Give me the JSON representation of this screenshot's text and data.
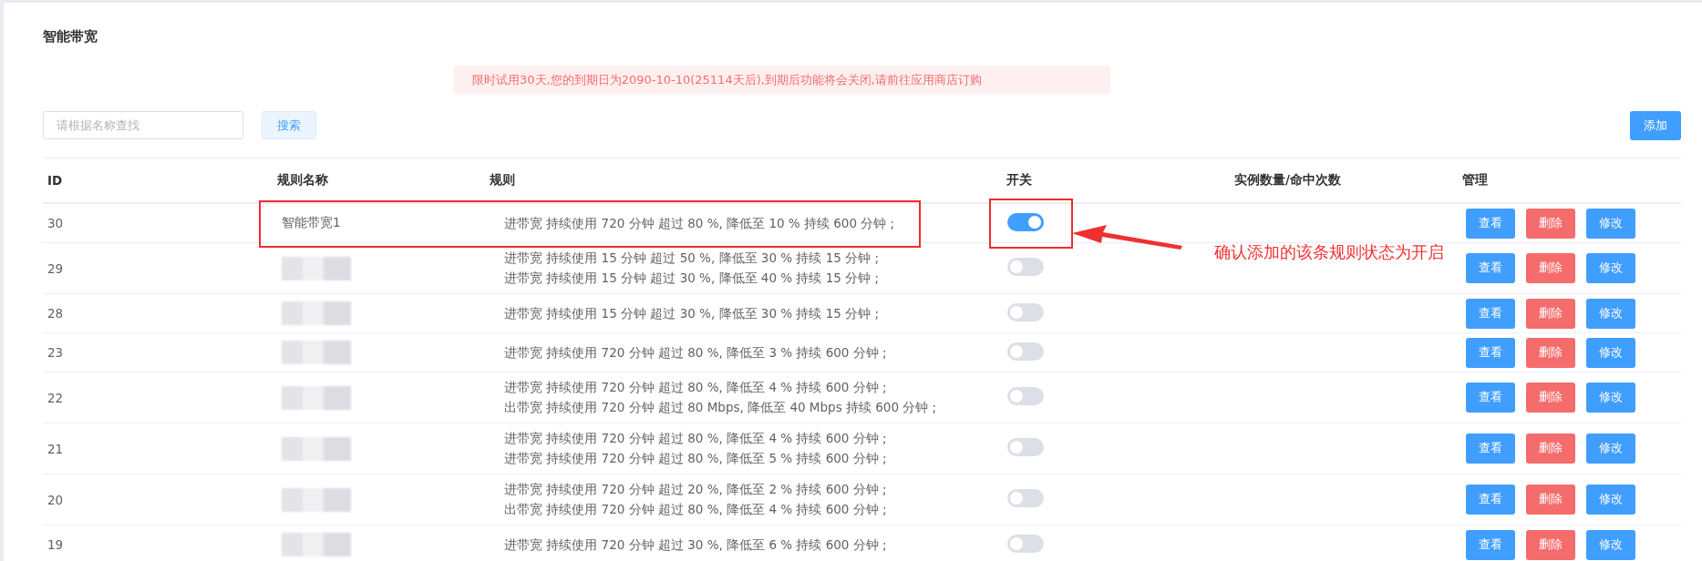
{
  "page": {
    "title": "智能带宽"
  },
  "notice": "限时试用30天,您的到期日为2090-10-10(25114天后),到期后功能将会关闭,请前往应用商店订购",
  "search": {
    "placeholder": "请根据名称查找",
    "button": "搜索"
  },
  "add_button": "添加",
  "table": {
    "columns": [
      "ID",
      "规则名称",
      "规则",
      "开关",
      "实例数量/命中次数",
      "管理"
    ],
    "rows": [
      {
        "id": "30",
        "name": "智能带宽1",
        "name_blurred": false,
        "rules": [
          "进带宽 持续使用 720 分钟 超过 80 %, 降低至 10 % 持续 600 分钟 ;"
        ],
        "on": true,
        "actions": [
          {
            "label": "查看",
            "kind": "view"
          },
          {
            "label": "删除",
            "kind": "delete"
          },
          {
            "label": "修改",
            "kind": "edit"
          }
        ]
      },
      {
        "id": "29",
        "name_blurred": true,
        "rules": [
          "进带宽 持续使用 15 分钟 超过 50 %, 降低至 30 % 持续 15 分钟 ;",
          "进带宽 持续使用 15 分钟 超过 30 %, 降低至 40 % 持续 15 分钟 ;"
        ],
        "on": false,
        "actions": [
          {
            "label": "查看",
            "kind": "view"
          },
          {
            "label": "删除",
            "kind": "delete"
          },
          {
            "label": "修改",
            "kind": "edit"
          }
        ]
      },
      {
        "id": "28",
        "name_blurred": true,
        "rules": [
          "进带宽 持续使用 15 分钟 超过 30 %, 降低至 30 % 持续 15 分钟 ;"
        ],
        "on": false,
        "actions": [
          {
            "label": "查看",
            "kind": "view"
          },
          {
            "label": "删除",
            "kind": "delete"
          },
          {
            "label": "修改",
            "kind": "edit"
          }
        ]
      },
      {
        "id": "23",
        "name_blurred": true,
        "rules": [
          "进带宽 持续使用 720 分钟 超过 80 %, 降低至 3 % 持续 600 分钟 ;"
        ],
        "on": false,
        "actions": [
          {
            "label": "查看",
            "kind": "view"
          },
          {
            "label": "删除",
            "kind": "delete"
          },
          {
            "label": "修改",
            "kind": "edit"
          }
        ]
      },
      {
        "id": "22",
        "name_blurred": true,
        "rules": [
          "进带宽 持续使用 720 分钟 超过 80 %, 降低至 4 % 持续 600 分钟 ;",
          "出带宽 持续使用 720 分钟 超过 80 Mbps, 降低至 40 Mbps 持续 600 分钟 ;"
        ],
        "on": false,
        "actions": [
          {
            "label": "查看",
            "kind": "view"
          },
          {
            "label": "删除",
            "kind": "delete"
          },
          {
            "label": "修改",
            "kind": "edit"
          }
        ]
      },
      {
        "id": "21",
        "name_blurred": true,
        "rules": [
          "进带宽 持续使用 720 分钟 超过 80 %, 降低至 4 % 持续 600 分钟 ;",
          "进带宽 持续使用 720 分钟 超过 80 %, 降低至 5 % 持续 600 分钟 ;"
        ],
        "on": false,
        "actions": [
          {
            "label": "查看",
            "kind": "view"
          },
          {
            "label": "删除",
            "kind": "delete"
          },
          {
            "label": "修改",
            "kind": "edit"
          }
        ]
      },
      {
        "id": "20",
        "name_blurred": true,
        "rules": [
          "进带宽 持续使用 720 分钟 超过 20 %, 降低至 2 % 持续 600 分钟 ;",
          "出带宽 持续使用 720 分钟 超过 80 %, 降低至 4 % 持续 600 分钟 ;"
        ],
        "on": false,
        "actions": [
          {
            "label": "查看",
            "kind": "view"
          },
          {
            "label": "删除",
            "kind": "delete"
          },
          {
            "label": "修改",
            "kind": "edit"
          }
        ]
      },
      {
        "id": "19",
        "name_blurred": true,
        "rules": [
          "进带宽 持续使用 720 分钟 超过 30 %, 降低至 6 % 持续 600 分钟 ;"
        ],
        "on": false,
        "actions": [
          {
            "label": "查看",
            "kind": "view"
          },
          {
            "label": "删除",
            "kind": "delete"
          },
          {
            "label": "修改",
            "kind": "edit"
          }
        ]
      }
    ]
  },
  "annotation": {
    "text": "确认添加的该条规则状态为开启"
  }
}
